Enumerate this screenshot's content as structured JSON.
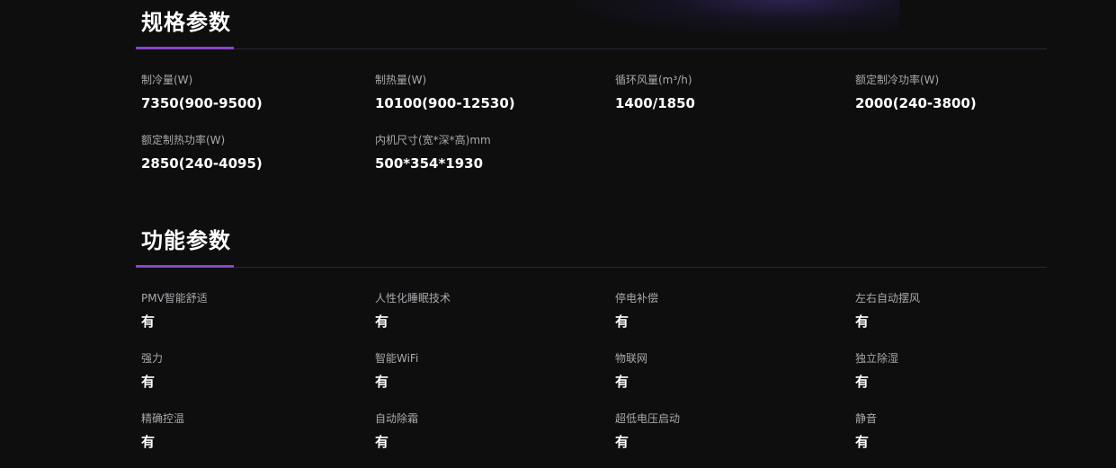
{
  "spec_section": {
    "title": "规格参数",
    "items": [
      {
        "label": "制冷量(W)",
        "value": "7350(900-9500)"
      },
      {
        "label": "制热量(W)",
        "value": "10100(900-12530)"
      },
      {
        "label": "循环风量(m³/h)",
        "value": "1400/1850"
      },
      {
        "label": "额定制冷功率(W)",
        "value": "2000(240-3800)"
      },
      {
        "label": "额定制热功率(W)",
        "value": "2850(240-4095)"
      },
      {
        "label": "内机尺寸(宽*深*高)mm",
        "value": "500*354*1930"
      }
    ]
  },
  "function_section": {
    "title": "功能参数",
    "items": [
      {
        "label": "PMV智能舒适",
        "value": "有"
      },
      {
        "label": "人性化睡眠技术",
        "value": "有"
      },
      {
        "label": "停电补偿",
        "value": "有"
      },
      {
        "label": "左右自动摆风",
        "value": "有"
      },
      {
        "label": "强力",
        "value": "有"
      },
      {
        "label": "智能WiFi",
        "value": "有"
      },
      {
        "label": "物联网",
        "value": "有"
      },
      {
        "label": "独立除湿",
        "value": "有"
      },
      {
        "label": "精确控温",
        "value": "有"
      },
      {
        "label": "自动除霜",
        "value": "有"
      },
      {
        "label": "超低电压启动",
        "value": "有"
      },
      {
        "label": "静音",
        "value": "有"
      }
    ]
  }
}
